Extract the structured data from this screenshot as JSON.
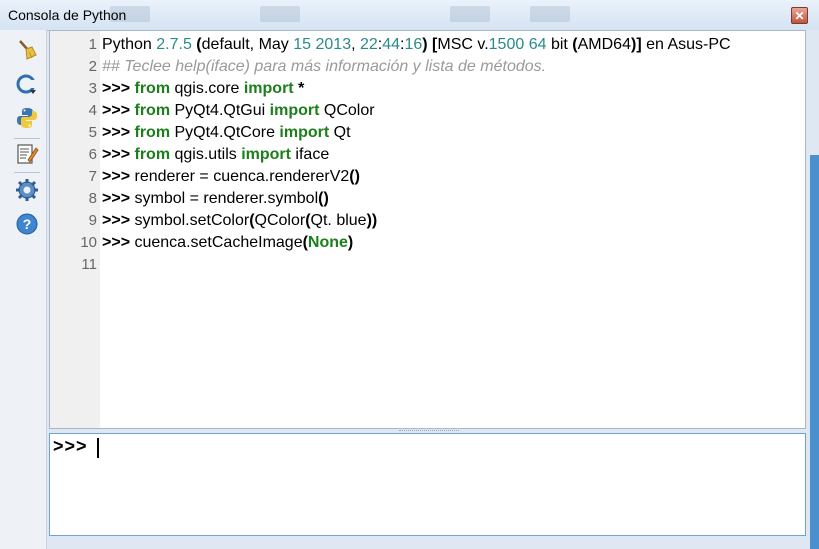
{
  "window": {
    "title": "Consola de Python",
    "close_label": "✕"
  },
  "toolbar": {
    "tools": [
      {
        "name": "clear-console",
        "icon": "broom-icon"
      },
      {
        "name": "import-class",
        "icon": "class-import-icon"
      },
      {
        "name": "run-command",
        "icon": "python-icon"
      },
      {
        "name": "show-editor",
        "icon": "editor-icon"
      },
      {
        "name": "settings",
        "icon": "gear-icon"
      },
      {
        "name": "help",
        "icon": "help-icon"
      }
    ]
  },
  "editor": {
    "lines": [
      {
        "n": "1",
        "segs": [
          {
            "t": "Python ",
            "c": "str"
          },
          {
            "t": "2.7.5",
            "c": "num"
          },
          {
            "t": " (",
            "c": "op"
          },
          {
            "t": "default, May ",
            "c": "str"
          },
          {
            "t": "15",
            "c": "num"
          },
          {
            "t": " ",
            "c": "str"
          },
          {
            "t": "2013",
            "c": "num"
          },
          {
            "t": ", ",
            "c": "str"
          },
          {
            "t": "22",
            "c": "num"
          },
          {
            "t": ":",
            "c": "str"
          },
          {
            "t": "44",
            "c": "num"
          },
          {
            "t": ":",
            "c": "str"
          },
          {
            "t": "16",
            "c": "num"
          },
          {
            "t": ") [",
            "c": "op"
          },
          {
            "t": "MSC v.",
            "c": "str"
          },
          {
            "t": "1500",
            "c": "num"
          },
          {
            "t": " ",
            "c": "str"
          },
          {
            "t": "64",
            "c": "num"
          },
          {
            "t": " bit ",
            "c": "str"
          },
          {
            "t": "(",
            "c": "op"
          },
          {
            "t": "AMD64",
            "c": "str"
          },
          {
            "t": ")]",
            "c": "op"
          },
          {
            "t": " en Asus-PC",
            "c": "str"
          }
        ]
      },
      {
        "n": "2",
        "segs": [
          {
            "t": "## Teclee help(iface) para más información y lista de métodos.",
            "c": "cmt"
          }
        ]
      },
      {
        "n": "3",
        "segs": [
          {
            "t": ">>> ",
            "c": "prompt"
          },
          {
            "t": "from",
            "c": "kw"
          },
          {
            "t": " qgis.core ",
            "c": "str"
          },
          {
            "t": "import",
            "c": "kw"
          },
          {
            "t": " *",
            "c": "op"
          }
        ]
      },
      {
        "n": "4",
        "segs": [
          {
            "t": ">>> ",
            "c": "prompt"
          },
          {
            "t": "from",
            "c": "kw"
          },
          {
            "t": " PyQt4.QtGui ",
            "c": "str"
          },
          {
            "t": "import",
            "c": "kw"
          },
          {
            "t": " QColor",
            "c": "str"
          }
        ]
      },
      {
        "n": "5",
        "segs": [
          {
            "t": ">>> ",
            "c": "prompt"
          },
          {
            "t": "from",
            "c": "kw"
          },
          {
            "t": " PyQt4.QtCore ",
            "c": "str"
          },
          {
            "t": "import",
            "c": "kw"
          },
          {
            "t": " Qt",
            "c": "str"
          }
        ]
      },
      {
        "n": "6",
        "segs": [
          {
            "t": ">>> ",
            "c": "prompt"
          },
          {
            "t": "from",
            "c": "kw"
          },
          {
            "t": " qgis.utils ",
            "c": "str"
          },
          {
            "t": "import",
            "c": "kw"
          },
          {
            "t": " iface",
            "c": "str"
          }
        ]
      },
      {
        "n": "7",
        "segs": [
          {
            "t": ">>> ",
            "c": "prompt"
          },
          {
            "t": "renderer = cuenca.rendererV2",
            "c": "str"
          },
          {
            "t": "()",
            "c": "op"
          }
        ]
      },
      {
        "n": "8",
        "segs": [
          {
            "t": ">>> ",
            "c": "prompt"
          },
          {
            "t": "symbol = renderer.symbol",
            "c": "str"
          },
          {
            "t": "()",
            "c": "op"
          }
        ]
      },
      {
        "n": "9",
        "segs": [
          {
            "t": ">>> ",
            "c": "prompt"
          },
          {
            "t": "symbol.setColor",
            "c": "str"
          },
          {
            "t": "(",
            "c": "op"
          },
          {
            "t": "QColor",
            "c": "str"
          },
          {
            "t": "(",
            "c": "op"
          },
          {
            "t": "Qt. blue",
            "c": "str"
          },
          {
            "t": "))",
            "c": "op"
          }
        ]
      },
      {
        "n": "10",
        "segs": [
          {
            "t": ">>> ",
            "c": "prompt"
          },
          {
            "t": "cuenca.setCacheImage",
            "c": "str"
          },
          {
            "t": "(",
            "c": "op"
          },
          {
            "t": "None",
            "c": "kw"
          },
          {
            "t": ")",
            "c": "op"
          }
        ]
      },
      {
        "n": "11",
        "segs": []
      }
    ]
  },
  "input": {
    "prompt": ">>>"
  },
  "colors": {
    "keyword": "#1b7f1b",
    "number": "#2a8a8a",
    "comment": "#9a9a9a",
    "accent_strip": "#4a90cf"
  }
}
